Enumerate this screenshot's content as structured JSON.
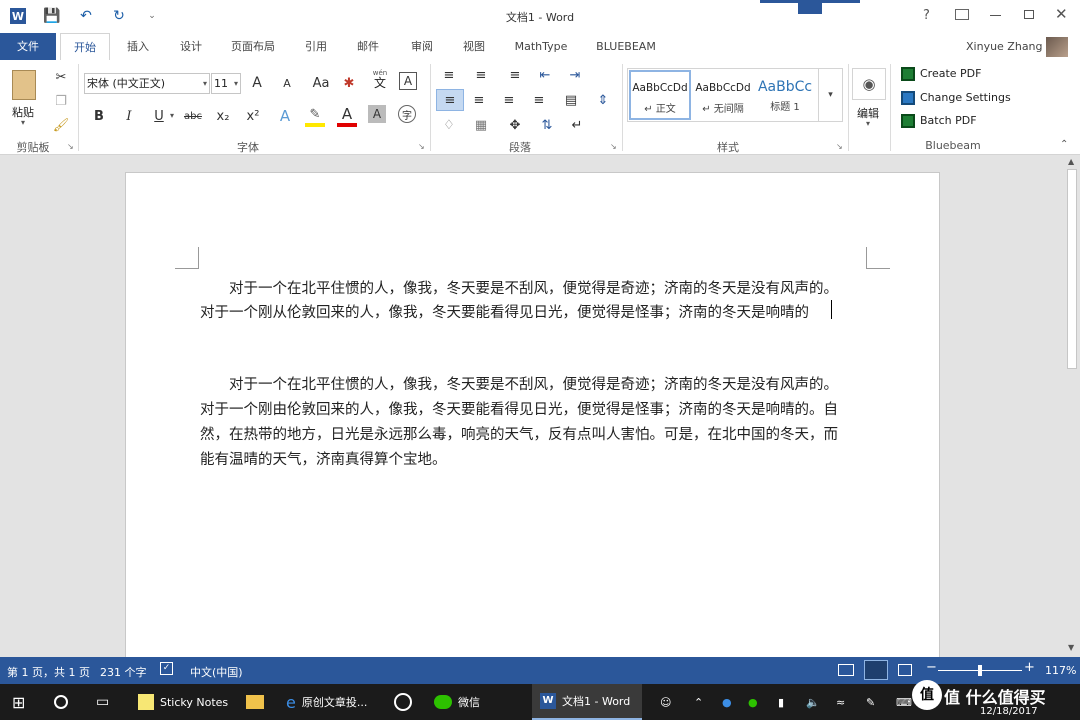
{
  "window": {
    "title": "文档1 - Word",
    "help": "?"
  },
  "tabs": [
    "文件",
    "开始",
    "插入",
    "设计",
    "页面布局",
    "引用",
    "邮件",
    "审阅",
    "视图",
    "MathType",
    "BLUEBEAM"
  ],
  "user": {
    "name": "Xinyue Zhang"
  },
  "clipboard": {
    "paste_label": "粘贴",
    "group_label": "剪贴板"
  },
  "font": {
    "name": "宋体 (中文正文)",
    "size": "11",
    "group_label": "字体",
    "bold": "B",
    "italic": "I",
    "underline": "U",
    "strike": "abc",
    "subscript": "x₂",
    "superscript": "x²",
    "grow": "A",
    "shrink": "A",
    "case": "Aa",
    "wen": "wén",
    "wen_char": "文",
    "boxA": "A"
  },
  "paragraph": {
    "group_label": "段落"
  },
  "styles": {
    "items": [
      {
        "preview": "AaBbCcDd",
        "name": "↵ 正文"
      },
      {
        "preview": "AaBbCcDd",
        "name": "↵ 无间隔"
      },
      {
        "preview": "AaBbCc",
        "name": "标题 1"
      }
    ],
    "group_label": "样式"
  },
  "editing": {
    "label": "编辑"
  },
  "bluebeam": {
    "items": [
      "Create PDF",
      "Change Settings",
      "Batch PDF"
    ],
    "group_label": "Bluebeam"
  },
  "document": {
    "lines": [
      "对于一个在北平住惯的人，像我，冬天要是不刮风，便觉得是奇迹；济南的冬天是没有风声的。",
      "对于一个刚从伦敦回来的人，像我，冬天要能看得见日光，便觉得是怪事；济南的冬天是响晴的",
      "对于一个在北平住惯的人，像我，冬天要是不刮风，便觉得是奇迹；济南的冬天是没有风声的。",
      "对于一个刚由伦敦回来的人，像我，冬天要能看得见日光，便觉得是怪事；济南的冬天是响晴的。自",
      "然，在热带的地方，日光是永远那么毒，响亮的天气，反有点叫人害怕。可是，在北中国的冬天，而",
      "能有温晴的天气，济南真得算个宝地。"
    ]
  },
  "status": {
    "page": "第 1 页，共 1 页",
    "words": "231 个字",
    "lang": "中文(中国)",
    "zoom": "117%"
  },
  "taskbar": {
    "apps": [
      "Sticky Notes",
      "原创文章投...",
      "微信",
      "文档1 - Word"
    ],
    "date": "12/18/2017",
    "watermark": "值 什么值得买"
  },
  "colors": {
    "accent": "#2b579a",
    "file_tab": "#2b579a",
    "font_color": "#e00000",
    "highlight": "#ffe800"
  }
}
